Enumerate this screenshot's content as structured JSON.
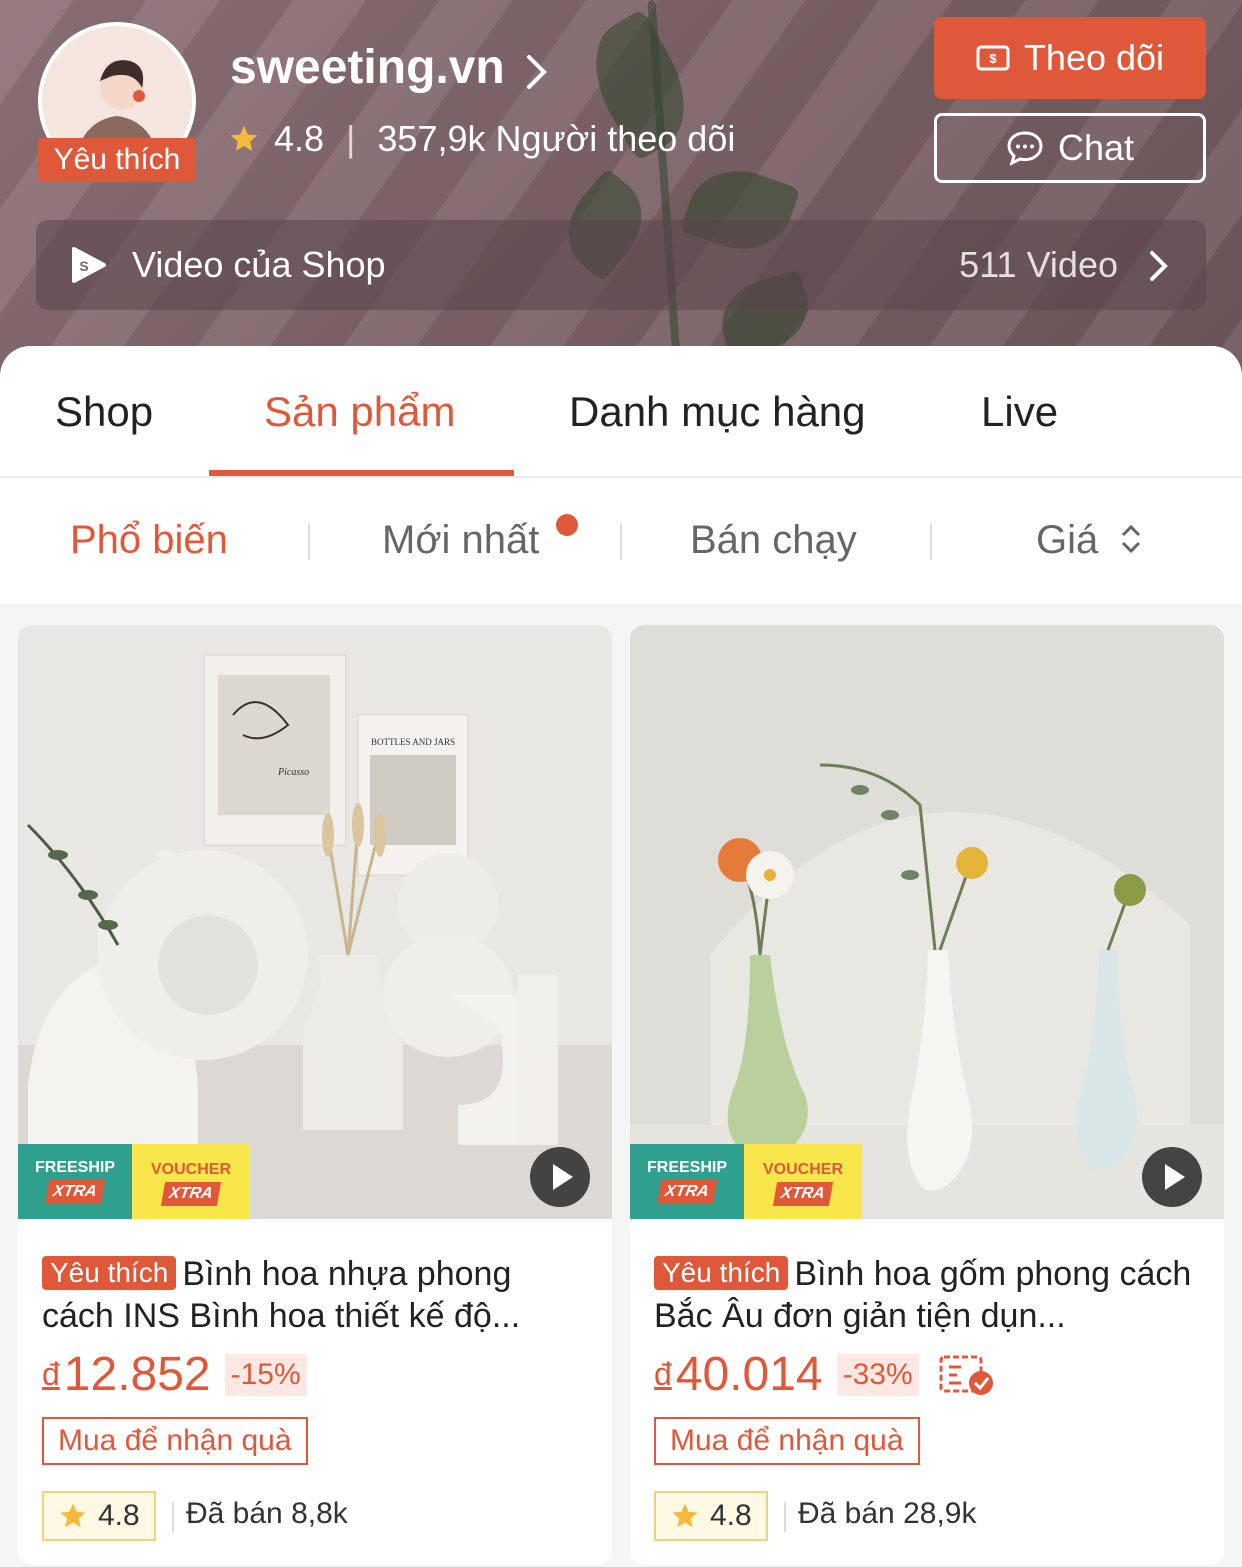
{
  "shop": {
    "name": "sweeting.vn",
    "badge": "Yêu thích",
    "rating": "4.8",
    "followers": "357,9k Người theo dõi",
    "follow_label": "Theo dõi",
    "chat_label": "Chat"
  },
  "video": {
    "label": "Video của Shop",
    "count": "511 Video"
  },
  "tabs": [
    {
      "label": "Shop"
    },
    {
      "label": "Sản phẩm"
    },
    {
      "label": "Danh mục hàng"
    },
    {
      "label": "Live"
    }
  ],
  "sort": [
    {
      "label": "Phổ biến"
    },
    {
      "label": "Mới nhất"
    },
    {
      "label": "Bán chạy"
    },
    {
      "label": "Giá"
    }
  ],
  "tags": {
    "freeship": "FREESHIP",
    "voucher": "VOUCHER",
    "xtra": "XTRA"
  },
  "products": [
    {
      "badge": "Yêu thích",
      "title": "Bình hoa nhựa phong cách INS Bình hoa thiết kế độ...",
      "currency": "đ",
      "price": "12.852",
      "discount": "-15%",
      "promo": "Mua để nhận quà",
      "rating": "4.8",
      "sold": "Đã bán 8,8k",
      "photo_texts": {
        "poster_left_sign": "Picasso",
        "poster_right": "BOTTLES AND JARS"
      }
    },
    {
      "badge": "Yêu thích",
      "title": "Bình hoa gốm phong cách Bắc Âu đơn giản tiện dụn...",
      "currency": "đ",
      "price": "40.014",
      "discount": "-33%",
      "promo": "Mua để nhận quà",
      "rating": "4.8",
      "sold": "Đã bán 28,9k"
    }
  ],
  "colors": {
    "accent": "#e0583a",
    "freeship_bg": "#2fa08d",
    "voucher_bg": "#f8e64a",
    "header_bg": "#7d6468"
  },
  "icons": [
    "chevron-right-icon",
    "star-icon",
    "ticket-icon",
    "chat-bubble-icon",
    "shopee-video-icon",
    "sort-updown-icon",
    "play-icon",
    "voucher-check-icon"
  ]
}
